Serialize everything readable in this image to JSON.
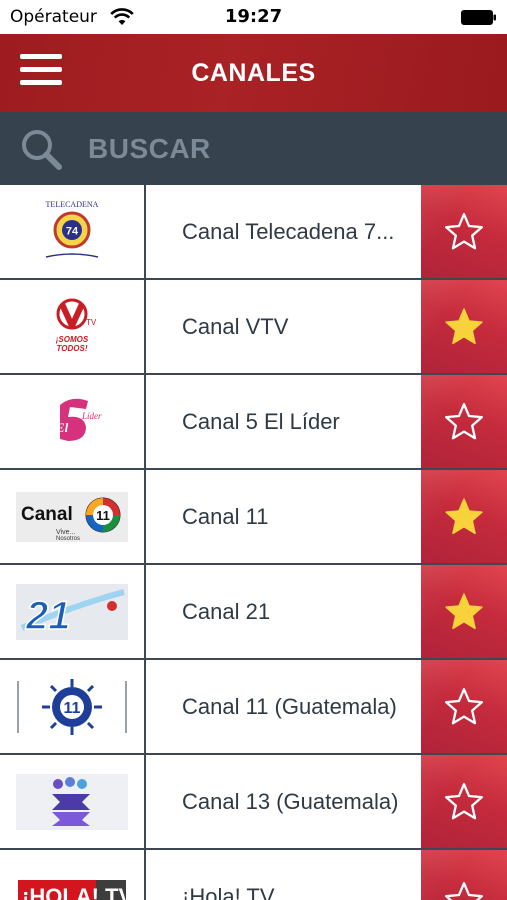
{
  "status_bar": {
    "carrier": "Opérateur",
    "time": "19:27"
  },
  "nav": {
    "title": "CANALES",
    "menu_icon": "hamburger-menu-icon"
  },
  "search": {
    "placeholder": "BUSCAR",
    "icon": "search-icon"
  },
  "colors": {
    "nav_bar": "#a42024",
    "search_bar": "#36434f",
    "search_text": "#7c8996",
    "favorite_cell": "#c52b3c",
    "star_filled": "#f7d23b",
    "star_outline": "#ffffff",
    "row_divider": "#3e4852"
  },
  "channels": [
    {
      "name": "Canal Telecadena 7...",
      "logo": "telecadena-74-logo",
      "favorite": false
    },
    {
      "name": "Canal VTV",
      "logo": "vtv-logo",
      "favorite": true
    },
    {
      "name": "Canal 5 El Líder",
      "logo": "canal-5-el-lider-logo",
      "favorite": false
    },
    {
      "name": "Canal 11",
      "logo": "canal-11-logo",
      "favorite": true
    },
    {
      "name": "Canal 21",
      "logo": "canal-21-logo",
      "favorite": true
    },
    {
      "name": "Canal 11 (Guatemala)",
      "logo": "canal-11-guatemala-logo",
      "favorite": false
    },
    {
      "name": "Canal 13 (Guatemala)",
      "logo": "canal-13-guatemala-logo",
      "favorite": false
    },
    {
      "name": "¡Hola! TV",
      "logo": "hola-tv-logo",
      "favorite": false
    }
  ],
  "logo_text": {
    "telecadena": "TELECADENA",
    "telecadena_num": "74",
    "vtv_tagline1": "¡SOMOS",
    "vtv_tagline2": "TODOS!",
    "canal5": "El Líder",
    "canal11": "Canal",
    "canal11_sub": "Vive... Nosotros",
    "canal21": "21",
    "guate11": "11",
    "hola": "¡HOLA! TV"
  }
}
